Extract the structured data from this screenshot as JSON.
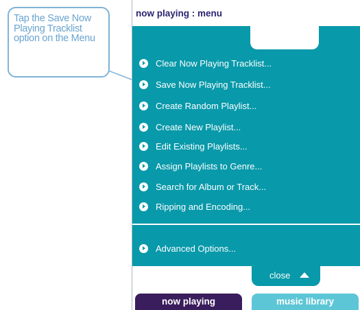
{
  "callout": {
    "text": "Tap the Save Now Playing Tracklist option on the Menu"
  },
  "header": {
    "title": "now playing : menu"
  },
  "menu": {
    "items": [
      {
        "label": "Clear Now Playing Tracklist..."
      },
      {
        "label": "Save Now Playing Tracklist..."
      },
      {
        "label": "Create Random Playlist..."
      },
      {
        "label": "Create New Playlist..."
      },
      {
        "label": "Edit Existing Playlists..."
      },
      {
        "label": "Assign Playlists to Genre..."
      },
      {
        "label": "Search for Album or Track..."
      },
      {
        "label": "Ripping and Encoding..."
      }
    ],
    "advanced": {
      "label": "Advanced Options..."
    },
    "close_label": "close"
  },
  "tabs": {
    "now_playing": "now playing",
    "music_library": "music library"
  },
  "colors": {
    "teal": "#0899aa",
    "header_text": "#2b2470",
    "callout": "#6aa5d0",
    "tab_now_playing": "#3a1d5c",
    "tab_music_library": "#5cc6d6"
  }
}
